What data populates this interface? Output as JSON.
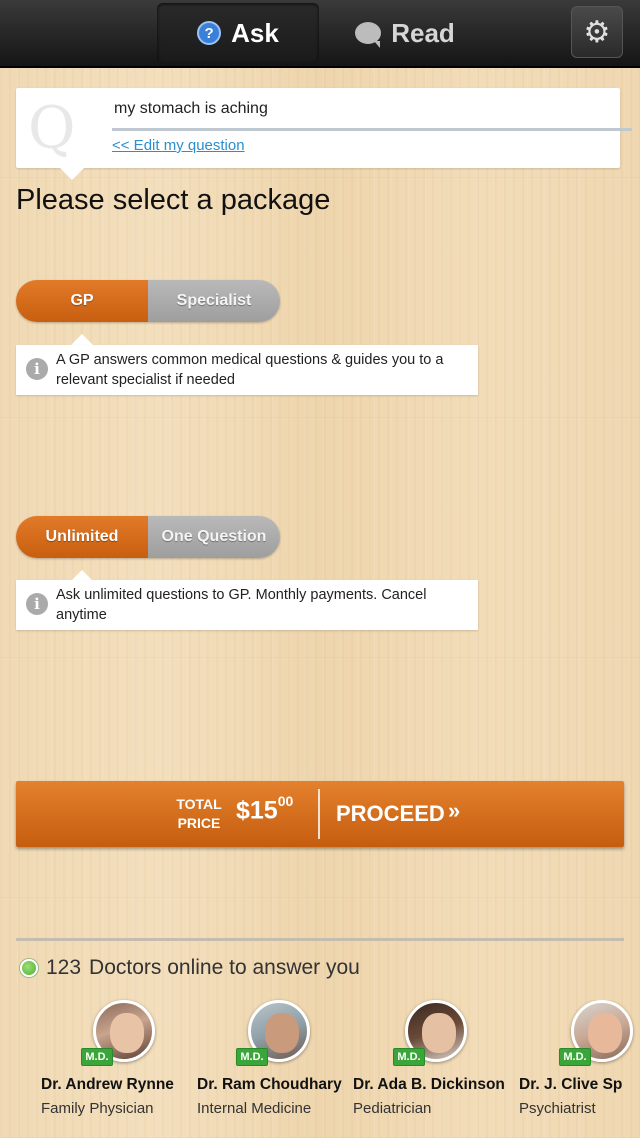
{
  "topbar": {
    "ask_label": "Ask",
    "read_label": "Read",
    "icons": {
      "ask": "question-circle-icon",
      "read": "speech-bubble-icon",
      "settings": "gear-icon"
    }
  },
  "question": {
    "text": "my stomach is aching",
    "edit_link": "<< Edit my question"
  },
  "heading": "Please select a package",
  "doctor_type": {
    "options": [
      "GP",
      "Specialist"
    ],
    "selected": "GP",
    "info": "A GP answers common medical questions & guides you to a relevant specialist if needed"
  },
  "plan": {
    "options": [
      "Unlimited",
      "One Question"
    ],
    "selected": "Unlimited",
    "info": "Ask unlimited questions to GP. Monthly payments. Cancel anytime"
  },
  "checkout": {
    "total_label_1": "TOTAL",
    "total_label_2": "PRICE",
    "price_main": "$15",
    "price_cents": "00",
    "proceed_label": "PROCEED",
    "chevron": "»"
  },
  "online": {
    "count": "123",
    "text": "Doctors online to answer you"
  },
  "doctors": [
    {
      "badge": "M.D.",
      "name": "Dr. Andrew Rynne",
      "specialty": "Family Physician"
    },
    {
      "badge": "M.D.",
      "name": "Dr. Ram Choudhary",
      "specialty": "Internal Medicine"
    },
    {
      "badge": "M.D.",
      "name": "Dr. Ada B. Dickinson",
      "specialty": "Pediatrician"
    },
    {
      "badge": "M.D.",
      "name": "Dr. J. Clive Sp",
      "specialty": "Psychiatrist"
    }
  ],
  "colors": {
    "accent_orange": "#d96e1f",
    "toggle_off": "#a9a9a9",
    "link_blue": "#2a8fd0",
    "md_green": "#3aa63a"
  }
}
